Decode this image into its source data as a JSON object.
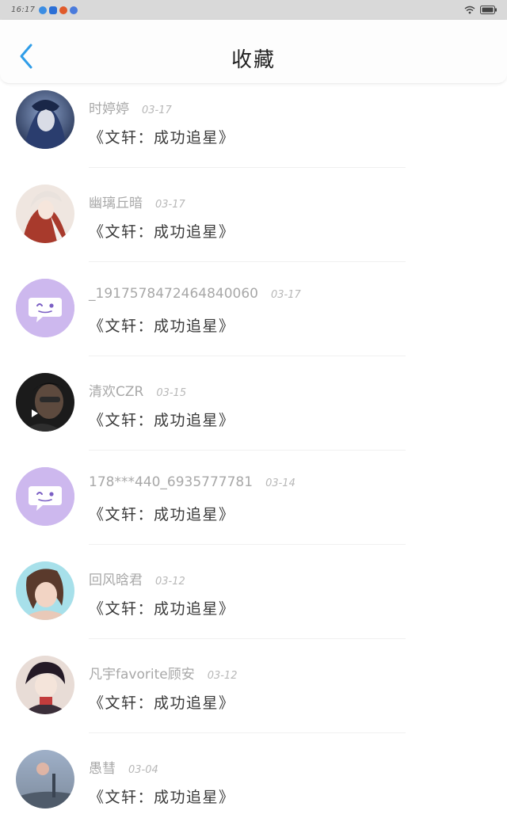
{
  "status_bar": {
    "time": "16:17",
    "notification_icon_colors": [
      "#3b8de3",
      "#2b6fd6",
      "#e05a2b",
      "#4a7bdc"
    ]
  },
  "header": {
    "title": "收藏",
    "back_icon": "chevron-left-icon",
    "accent": "#2f9de8"
  },
  "favorites": [
    {
      "name": "时婷婷",
      "date": "03-17",
      "title": "《文轩：成功追星》",
      "avatar": "photo-anime-blue"
    },
    {
      "name": "幽璃丘暗",
      "date": "03-17",
      "title": "《文轩：成功追星》",
      "avatar": "photo-anime-red"
    },
    {
      "name": "_1917578472464840060",
      "date": "03-17",
      "title": "《文轩：成功追星》",
      "avatar": "default-chat-bubble"
    },
    {
      "name": "清欢CZR",
      "date": "03-15",
      "title": "《文轩：成功追星》",
      "avatar": "photo-dark"
    },
    {
      "name": "178***440_6935777781",
      "date": "03-14",
      "title": "《文轩：成功追星》",
      "avatar": "default-chat-bubble"
    },
    {
      "name": "回风晗君",
      "date": "03-12",
      "title": "《文轩：成功追星》",
      "avatar": "photo-girl"
    },
    {
      "name": "凡宇favorite顾安",
      "date": "03-12",
      "title": "《文轩：成功追星》",
      "avatar": "photo-anime-boy"
    },
    {
      "name": "愚彗",
      "date": "03-04",
      "title": "《文轩：成功追星》",
      "avatar": "photo-fog"
    }
  ]
}
